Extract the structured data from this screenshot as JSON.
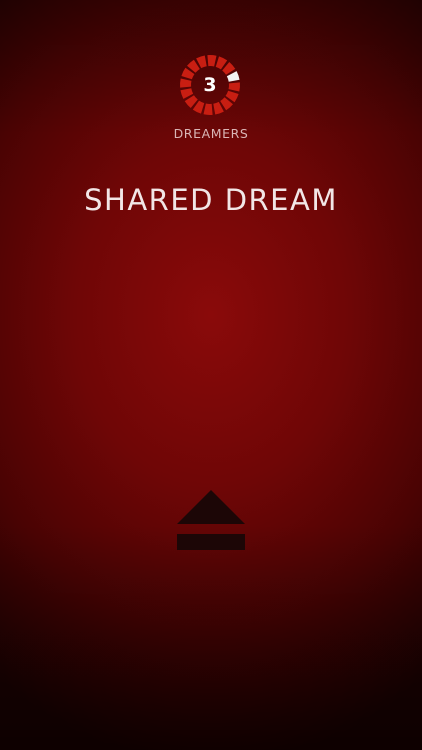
{
  "dreamers": {
    "count": "3",
    "label": "DREAMERS",
    "progress_segments_total": 16,
    "progress_segments_done": 1,
    "ring_color": "#c81e12",
    "done_color": "#f2f2f2"
  },
  "title": "SHARED DREAM",
  "eject": {
    "icon": "eject-icon",
    "color": "#1c0606"
  },
  "colors": {
    "background": "#6f0606",
    "text": "#f2e6e6"
  }
}
